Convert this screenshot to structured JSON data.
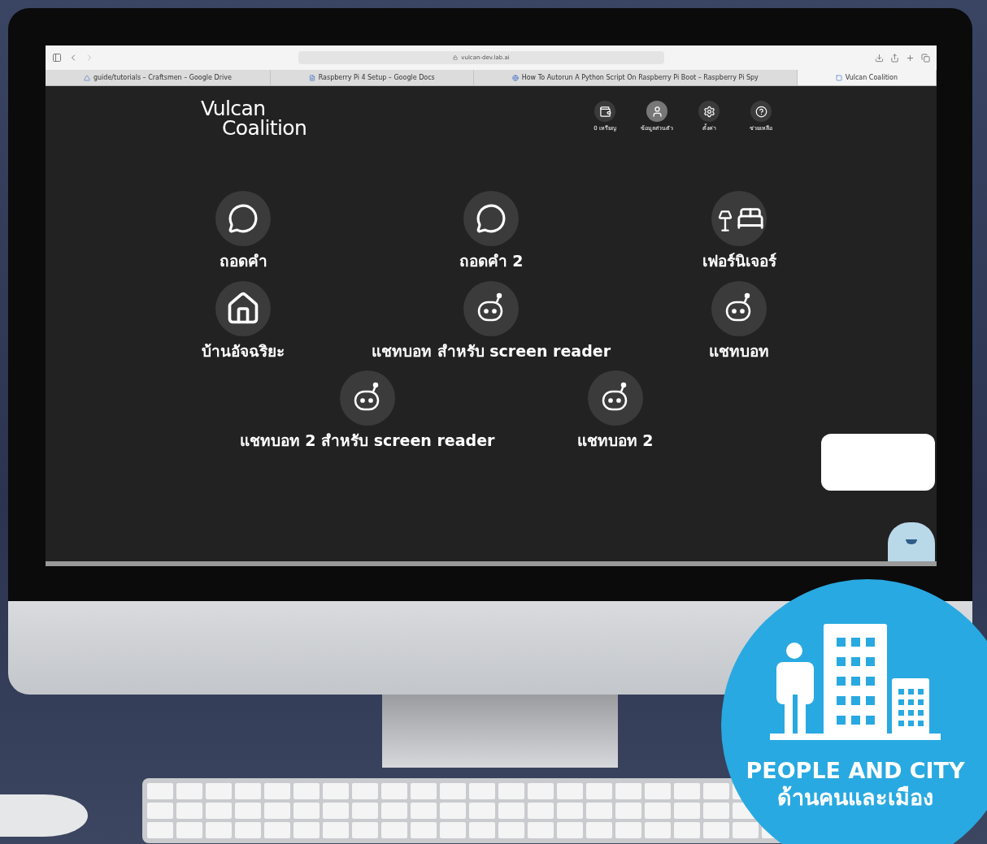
{
  "browser": {
    "address": "vulcan-dev.lab.ai",
    "tabs": [
      {
        "title": "guide/tutorials – Craftsmen – Google Drive",
        "kind": "drive",
        "selected": false
      },
      {
        "title": "Raspberry Pi 4 Setup – Google Docs",
        "kind": "docs",
        "selected": false
      },
      {
        "title": "How To Autorun A Python Script On Raspberry Pi Boot – Raspberry Pi Spy",
        "kind": "web",
        "selected": false
      },
      {
        "title": "Vulcan Coalition",
        "kind": "site",
        "selected": true
      }
    ]
  },
  "site": {
    "logo": [
      "Vulcan",
      "Coalition"
    ],
    "nav": [
      {
        "label": "0 เหรียญ",
        "kind": "wallet"
      },
      {
        "label": "ข้อมูลส่วนตัว",
        "kind": "user"
      },
      {
        "label": "ตั้งค่า",
        "kind": "settings"
      },
      {
        "label": "ช่วยเหลือ",
        "kind": "help"
      }
    ],
    "app_rows": [
      [
        {
          "label": "ถอดคำ",
          "kind": "chat"
        },
        {
          "label": "ถอดคำ 2",
          "kind": "chat"
        },
        {
          "label": "เฟอร์นิเจอร์",
          "kind": "furniture"
        }
      ],
      [
        {
          "label": "บ้านอัจฉริยะ",
          "kind": "home"
        },
        {
          "label": "แชทบอท สำหรับ screen reader",
          "kind": "bot"
        },
        {
          "label": "แชทบอท",
          "kind": "bot"
        }
      ],
      [
        {
          "label": "แชทบอท 2 สำหรับ screen reader",
          "kind": "bot"
        },
        {
          "label": "แชทบอท 2",
          "kind": "bot"
        }
      ]
    ]
  },
  "badge": {
    "title": "PEOPLE AND CITY",
    "subtitle": "ด้านคนและเมือง"
  }
}
